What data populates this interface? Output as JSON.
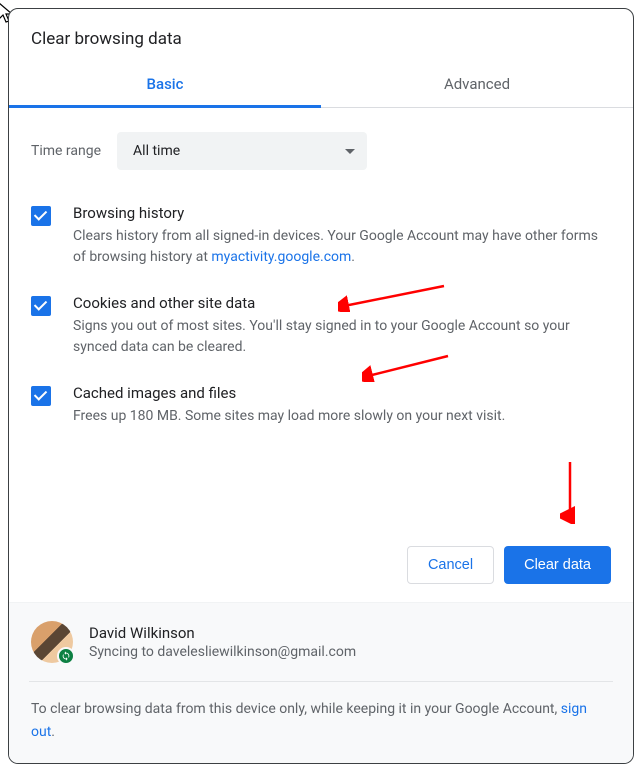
{
  "title": "Clear browsing data",
  "tabs": {
    "basic": "Basic",
    "advanced": "Advanced"
  },
  "timerange": {
    "label": "Time range",
    "value": "All time"
  },
  "options": {
    "history": {
      "title": "Browsing history",
      "desc_pre": "Clears history from all signed-in devices. Your Google Account may have other forms of browsing history at ",
      "link": "myactivity.google.com",
      "desc_post": "."
    },
    "cookies": {
      "title": "Cookies and other site data",
      "desc": "Signs you out of most sites. You'll stay signed in to your Google Account so your synced data can be cleared."
    },
    "cache": {
      "title": "Cached images and files",
      "desc": "Frees up 180 MB. Some sites may load more slowly on your next visit."
    }
  },
  "buttons": {
    "cancel": "Cancel",
    "clear": "Clear data"
  },
  "profile": {
    "name": "David Wilkinson",
    "sync": "Syncing to davelesliewilkinson@gmail.com"
  },
  "footer": {
    "pre": "To clear browsing data from this device only, while keeping it in your Google Account, ",
    "link": "sign out",
    "post": "."
  }
}
